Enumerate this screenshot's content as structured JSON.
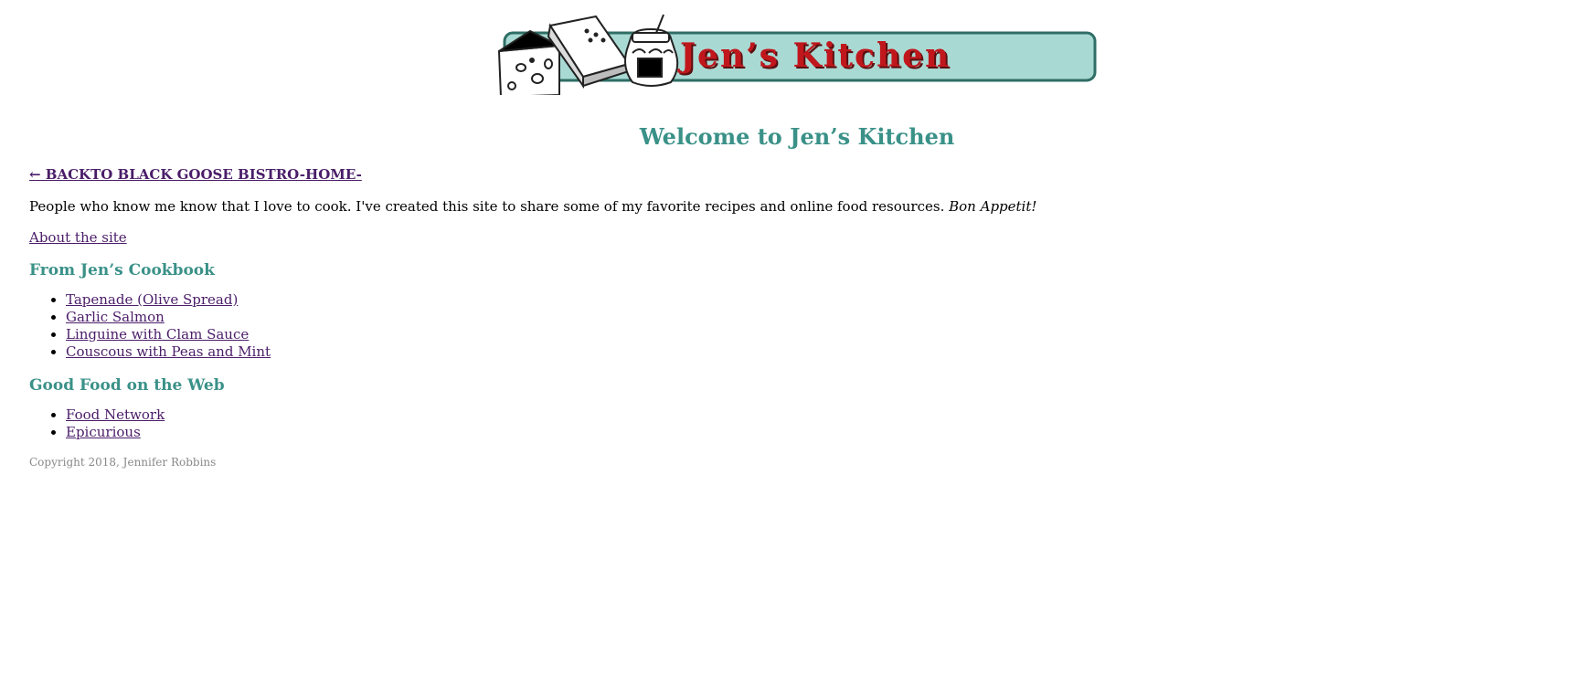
{
  "logo": {
    "title": "Jen’s Kitchen",
    "colors": {
      "panel": "#a9d9d3",
      "border": "#2f6e66",
      "text": "#c0171c",
      "shadow": "#5a0f10"
    }
  },
  "header": {
    "title": "Welcome to Jen’s Kitchen"
  },
  "nav": {
    "back_link": "← BACKTO BLACK GOOSE BISTRO-HOME-"
  },
  "intro": {
    "text": "People who know me know that I love to cook. I've created this site to share some of my favorite recipes and online food resources.",
    "emphasis": "Bon Appetit!"
  },
  "about_link": "About the site",
  "cookbook": {
    "heading": "From Jen’s Cookbook",
    "items": [
      {
        "label": "Tapenade (Olive Spread)"
      },
      {
        "label": "Garlic Salmon"
      },
      {
        "label": "Linguine with Clam Sauce"
      },
      {
        "label": "Couscous with Peas and Mint"
      }
    ]
  },
  "web": {
    "heading": "Good Food on the Web",
    "items": [
      {
        "label": "Food Network"
      },
      {
        "label": "Epicurious"
      }
    ]
  },
  "footer": {
    "copyright": "Copyright 2018, Jennifer Robbins"
  },
  "theme": {
    "heading_color": "#3a9188",
    "link_color": "#4b1d69",
    "muted_color": "#888888"
  }
}
